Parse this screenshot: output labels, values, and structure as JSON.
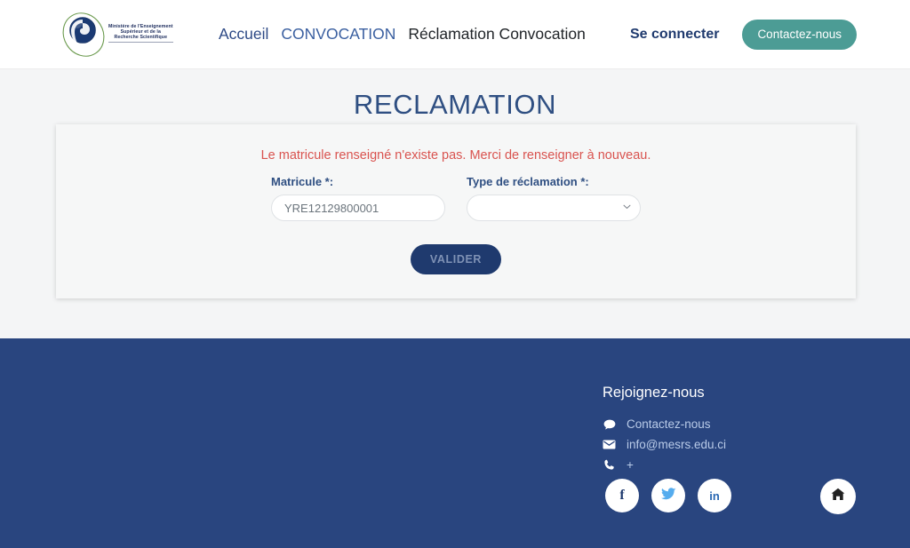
{
  "header": {
    "logo": {
      "icon": "ministry-emblem",
      "lines": [
        "Ministère de l'Enseignement",
        "Supérieur et de la",
        "Recherche Scientifique"
      ]
    },
    "nav": [
      {
        "label": "Accueil",
        "state": "link"
      },
      {
        "label": "CONVOCATION",
        "state": "link"
      },
      {
        "label": "Réclamation Convocation",
        "state": "active"
      }
    ],
    "login_label": "Se connecter",
    "contact_label": "Contactez-nous"
  },
  "main": {
    "title": "RECLAMATION",
    "alert": "Le matricule renseigné n'existe pas. Merci de renseigner à nouveau.",
    "form": {
      "matricule_label": "Matricule *:",
      "matricule_value": "YRE12129800001",
      "matricule_placeholder": "",
      "type_label": "Type de réclamation *:",
      "type_value": "",
      "submit_label": "VALIDER"
    }
  },
  "footer": {
    "heading": "Rejoignez-nous",
    "links": [
      {
        "icon": "chat-icon",
        "label": "Contactez-nous"
      },
      {
        "icon": "envelope-icon",
        "label": "info@mesrs.edu.ci"
      },
      {
        "icon": "phone-icon",
        "label": "+"
      }
    ],
    "socials": [
      {
        "icon": "facebook-icon",
        "label": "f"
      },
      {
        "icon": "twitter-icon",
        "label": ""
      },
      {
        "icon": "linkedin-icon",
        "label": "in"
      }
    ],
    "home_icon": "home-icon"
  },
  "colors": {
    "navy": "#29457f",
    "teal": "#4c9c95",
    "alert_red": "#d9534f",
    "title_blue": "#2f4f82"
  }
}
